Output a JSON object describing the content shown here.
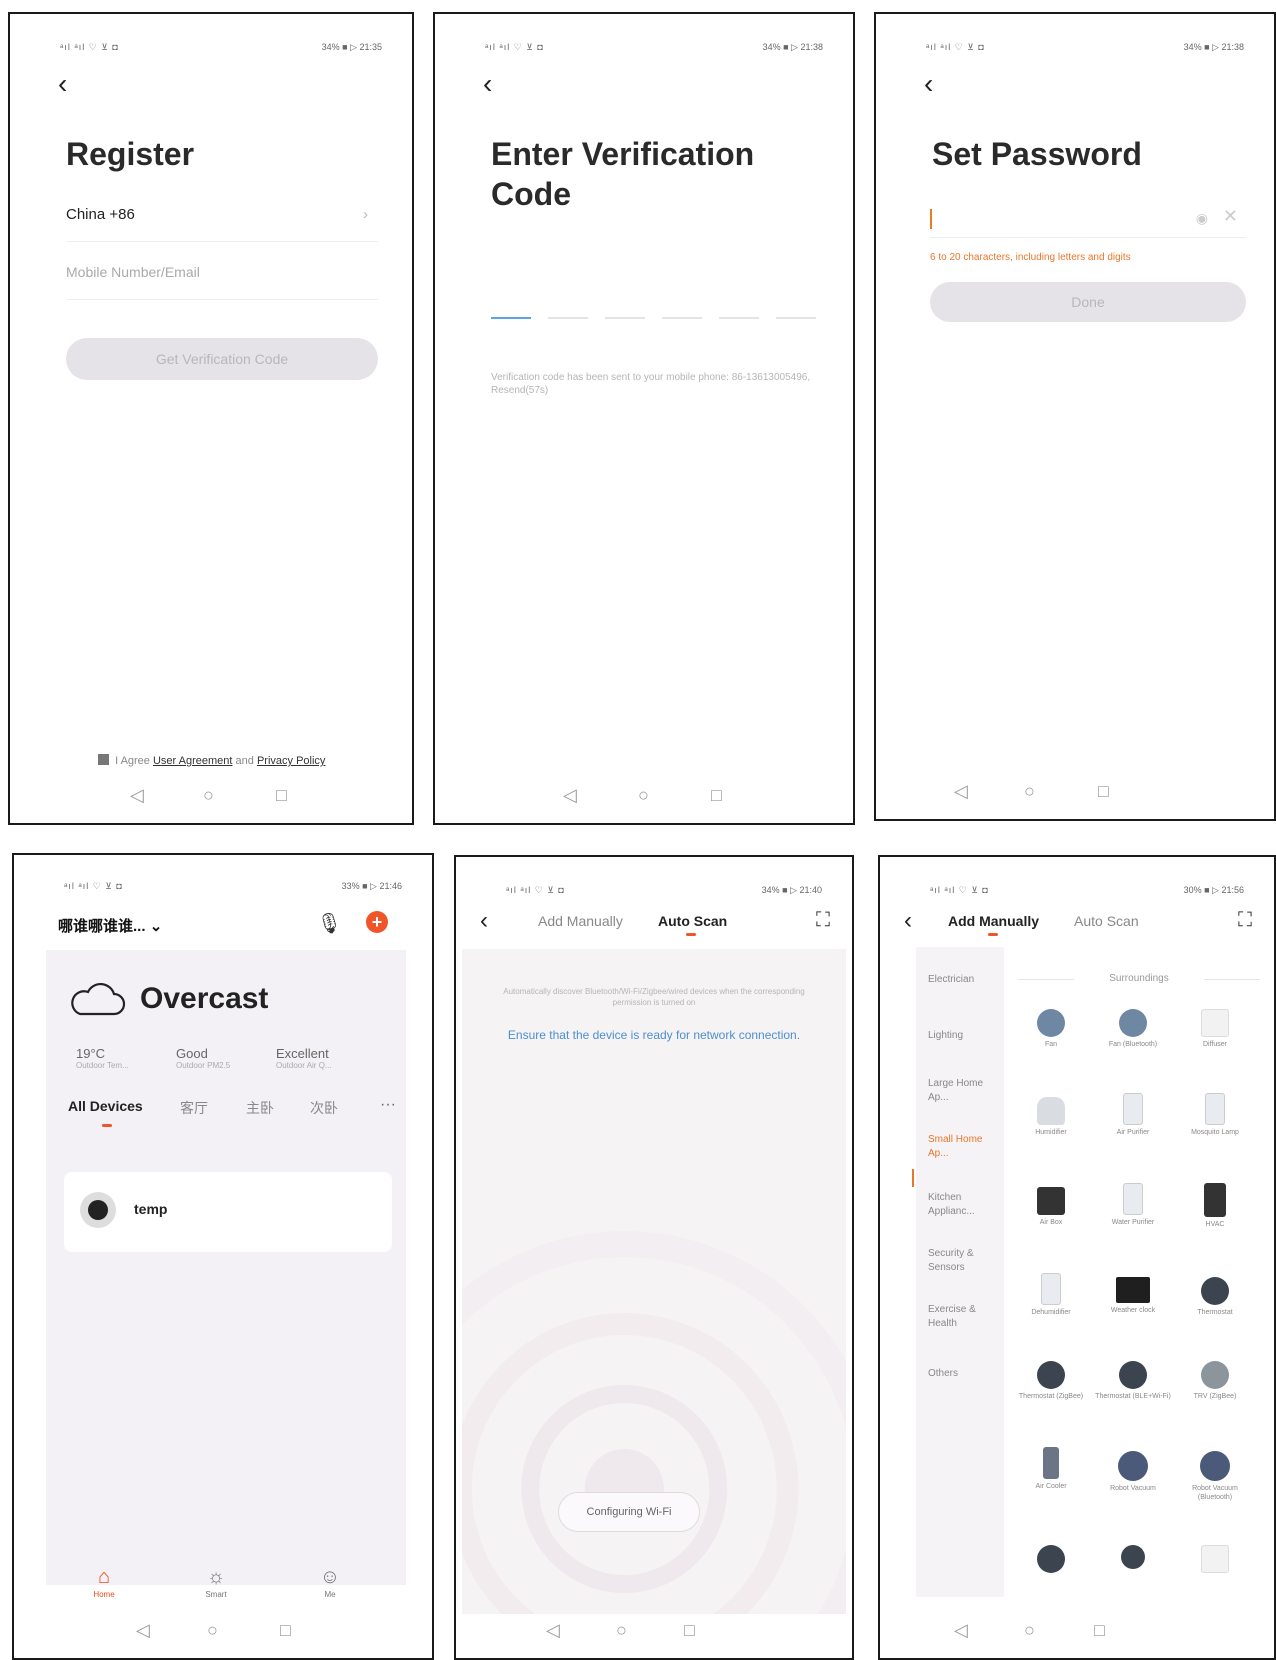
{
  "status": {
    "signal": "ᵃıl ᵃıl ♡ ⊻ ◘",
    "p1_right": "34% ■ ▷ 21:35",
    "p2_right": "34% ■ ▷ 21:38",
    "p3_right": "34% ■ ▷ 21:38",
    "p4_right": "33% ■ ▷ 21:46",
    "p5_right": "34% ■ ▷ 21:40",
    "p6_right": "30% ■ ▷ 21:56"
  },
  "nav": {
    "back": "◁",
    "home": "○",
    "recent": "□"
  },
  "register": {
    "back": "‹",
    "title": "Register",
    "country": "China +86",
    "country_chevron": "›",
    "mobile_placeholder": "Mobile Number/Email",
    "get_code_button": "Get Verification Code",
    "agree_text": "I Agree",
    "user_agreement": "User Agreement",
    "and": "and",
    "privacy_policy": "Privacy Policy"
  },
  "verify": {
    "back": "‹",
    "title": "Enter Verification Code",
    "note": "Verification code has been sent to your mobile phone: 86-13613005496, Resend(57s)"
  },
  "password": {
    "back": "‹",
    "title": "Set Password",
    "eye": "◉",
    "clear": "✕",
    "hint": "6 to 20 characters, including letters and digits",
    "done_button": "Done"
  },
  "home": {
    "name": "哪谁哪谁谁...",
    "name_chevron": "⌄",
    "mic": "🎙",
    "add": "+",
    "weather": "Overcast",
    "metrics": [
      {
        "value": "19°C",
        "label": "Outdoor Tem..."
      },
      {
        "value": "Good",
        "label": "Outdoor PM2.5"
      },
      {
        "value": "Excellent",
        "label": "Outdoor Air Q..."
      }
    ],
    "rooms": [
      "All Devices",
      "客厅",
      "主卧",
      "次卧"
    ],
    "more": "···",
    "device": "temp",
    "tabs": [
      {
        "icon": "⌂",
        "label": "Home"
      },
      {
        "icon": "☼",
        "label": "Smart"
      },
      {
        "icon": "☺",
        "label": "Me"
      }
    ]
  },
  "autoscan": {
    "back": "‹",
    "tab_manual": "Add Manually",
    "tab_auto": "Auto Scan",
    "scan_icon": "⛶",
    "desc": "Automatically discover Bluetooth/Wi-Fi/Zigbee/wired devices when the corresponding permission is turned on",
    "ensure": "Ensure that the device is ready for network connection.",
    "config_button": "Configuring Wi-Fi"
  },
  "manual": {
    "back": "‹",
    "tab_manual": "Add Manually",
    "tab_auto": "Auto Scan",
    "scan_icon": "⛶",
    "categories": [
      "Electrician",
      "Lighting",
      "Large Home Ap...",
      "Small Home Ap...",
      "Kitchen Applianc...",
      "Security & Sensors",
      "Exercise & Health",
      "Others"
    ],
    "active_category": "Small Home Ap...",
    "section": "Surroundings",
    "devices": [
      "Fan",
      "Fan (Bluetooth)",
      "Diffuser",
      "Humidifier",
      "Air Purifier",
      "Mosquito Lamp",
      "Air Box",
      "Water Purifier",
      "HVAC",
      "Dehumidifier",
      "Weather clock",
      "Thermostat",
      "Thermostat (ZigBee)",
      "Thermostat (BLE+Wi-Fi)",
      "TRV (ZigBee)",
      "Air Cooler",
      "Robot Vacuum",
      "Robot Vacuum (Bluetooth)"
    ]
  },
  "colors": {
    "accent": "#f0552a",
    "link_blue": "#4c8fd0",
    "hint_orange": "#e9772b",
    "disabled_pill": "#e5e3e8"
  }
}
